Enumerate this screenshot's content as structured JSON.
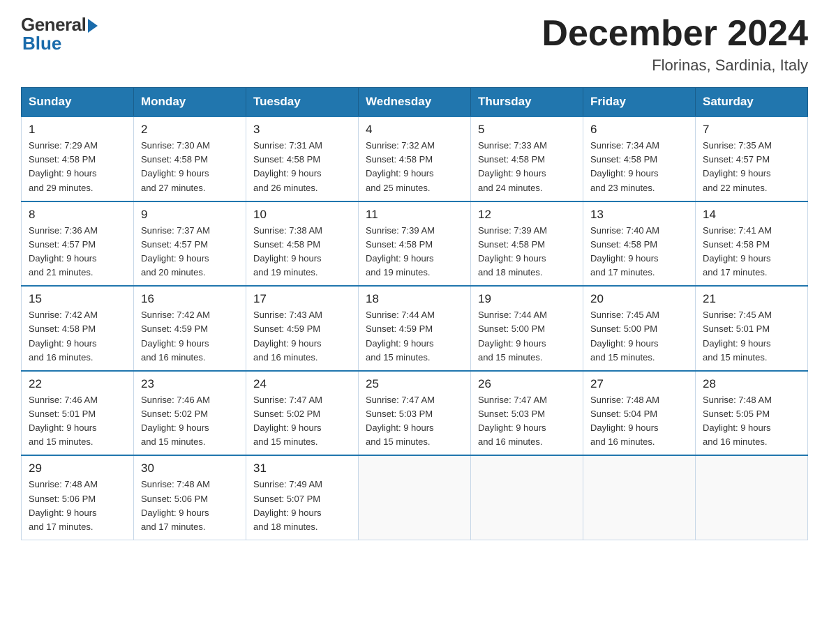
{
  "header": {
    "logo_general": "General",
    "logo_blue": "Blue",
    "title": "December 2024",
    "location": "Florinas, Sardinia, Italy"
  },
  "days_of_week": [
    "Sunday",
    "Monday",
    "Tuesday",
    "Wednesday",
    "Thursday",
    "Friday",
    "Saturday"
  ],
  "weeks": [
    [
      {
        "day": "1",
        "sunrise": "7:29 AM",
        "sunset": "4:58 PM",
        "daylight": "9 hours and 29 minutes."
      },
      {
        "day": "2",
        "sunrise": "7:30 AM",
        "sunset": "4:58 PM",
        "daylight": "9 hours and 27 minutes."
      },
      {
        "day": "3",
        "sunrise": "7:31 AM",
        "sunset": "4:58 PM",
        "daylight": "9 hours and 26 minutes."
      },
      {
        "day": "4",
        "sunrise": "7:32 AM",
        "sunset": "4:58 PM",
        "daylight": "9 hours and 25 minutes."
      },
      {
        "day": "5",
        "sunrise": "7:33 AM",
        "sunset": "4:58 PM",
        "daylight": "9 hours and 24 minutes."
      },
      {
        "day": "6",
        "sunrise": "7:34 AM",
        "sunset": "4:58 PM",
        "daylight": "9 hours and 23 minutes."
      },
      {
        "day": "7",
        "sunrise": "7:35 AM",
        "sunset": "4:57 PM",
        "daylight": "9 hours and 22 minutes."
      }
    ],
    [
      {
        "day": "8",
        "sunrise": "7:36 AM",
        "sunset": "4:57 PM",
        "daylight": "9 hours and 21 minutes."
      },
      {
        "day": "9",
        "sunrise": "7:37 AM",
        "sunset": "4:57 PM",
        "daylight": "9 hours and 20 minutes."
      },
      {
        "day": "10",
        "sunrise": "7:38 AM",
        "sunset": "4:58 PM",
        "daylight": "9 hours and 19 minutes."
      },
      {
        "day": "11",
        "sunrise": "7:39 AM",
        "sunset": "4:58 PM",
        "daylight": "9 hours and 19 minutes."
      },
      {
        "day": "12",
        "sunrise": "7:39 AM",
        "sunset": "4:58 PM",
        "daylight": "9 hours and 18 minutes."
      },
      {
        "day": "13",
        "sunrise": "7:40 AM",
        "sunset": "4:58 PM",
        "daylight": "9 hours and 17 minutes."
      },
      {
        "day": "14",
        "sunrise": "7:41 AM",
        "sunset": "4:58 PM",
        "daylight": "9 hours and 17 minutes."
      }
    ],
    [
      {
        "day": "15",
        "sunrise": "7:42 AM",
        "sunset": "4:58 PM",
        "daylight": "9 hours and 16 minutes."
      },
      {
        "day": "16",
        "sunrise": "7:42 AM",
        "sunset": "4:59 PM",
        "daylight": "9 hours and 16 minutes."
      },
      {
        "day": "17",
        "sunrise": "7:43 AM",
        "sunset": "4:59 PM",
        "daylight": "9 hours and 16 minutes."
      },
      {
        "day": "18",
        "sunrise": "7:44 AM",
        "sunset": "4:59 PM",
        "daylight": "9 hours and 15 minutes."
      },
      {
        "day": "19",
        "sunrise": "7:44 AM",
        "sunset": "5:00 PM",
        "daylight": "9 hours and 15 minutes."
      },
      {
        "day": "20",
        "sunrise": "7:45 AM",
        "sunset": "5:00 PM",
        "daylight": "9 hours and 15 minutes."
      },
      {
        "day": "21",
        "sunrise": "7:45 AM",
        "sunset": "5:01 PM",
        "daylight": "9 hours and 15 minutes."
      }
    ],
    [
      {
        "day": "22",
        "sunrise": "7:46 AM",
        "sunset": "5:01 PM",
        "daylight": "9 hours and 15 minutes."
      },
      {
        "day": "23",
        "sunrise": "7:46 AM",
        "sunset": "5:02 PM",
        "daylight": "9 hours and 15 minutes."
      },
      {
        "day": "24",
        "sunrise": "7:47 AM",
        "sunset": "5:02 PM",
        "daylight": "9 hours and 15 minutes."
      },
      {
        "day": "25",
        "sunrise": "7:47 AM",
        "sunset": "5:03 PM",
        "daylight": "9 hours and 15 minutes."
      },
      {
        "day": "26",
        "sunrise": "7:47 AM",
        "sunset": "5:03 PM",
        "daylight": "9 hours and 16 minutes."
      },
      {
        "day": "27",
        "sunrise": "7:48 AM",
        "sunset": "5:04 PM",
        "daylight": "9 hours and 16 minutes."
      },
      {
        "day": "28",
        "sunrise": "7:48 AM",
        "sunset": "5:05 PM",
        "daylight": "9 hours and 16 minutes."
      }
    ],
    [
      {
        "day": "29",
        "sunrise": "7:48 AM",
        "sunset": "5:06 PM",
        "daylight": "9 hours and 17 minutes."
      },
      {
        "day": "30",
        "sunrise": "7:48 AM",
        "sunset": "5:06 PM",
        "daylight": "9 hours and 17 minutes."
      },
      {
        "day": "31",
        "sunrise": "7:49 AM",
        "sunset": "5:07 PM",
        "daylight": "9 hours and 18 minutes."
      },
      null,
      null,
      null,
      null
    ]
  ],
  "labels": {
    "sunrise": "Sunrise:",
    "sunset": "Sunset:",
    "daylight": "Daylight:"
  }
}
